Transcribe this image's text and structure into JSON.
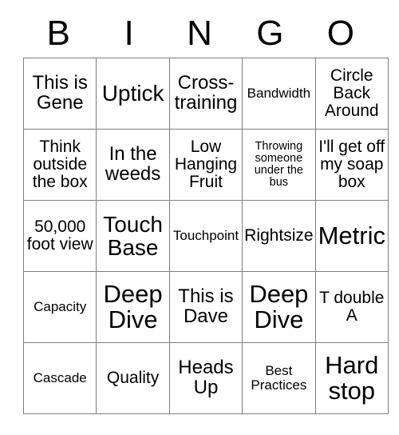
{
  "card": {
    "header_letters": [
      "B",
      "I",
      "N",
      "G",
      "O"
    ],
    "rows": [
      [
        {
          "text": "This is Gene",
          "size": "l"
        },
        {
          "text": "Uptick",
          "size": "xl"
        },
        {
          "text": "Cross-training",
          "size": "l"
        },
        {
          "text": "Bandwidth",
          "size": "s"
        },
        {
          "text": "Circle Back Around",
          "size": "m"
        }
      ],
      [
        {
          "text": "Think outside the box",
          "size": "m"
        },
        {
          "text": "In the weeds",
          "size": "l"
        },
        {
          "text": "Low Hanging Fruit",
          "size": "m"
        },
        {
          "text": "Throwing someone under the bus",
          "size": "xs"
        },
        {
          "text": "I'll get off my soap box",
          "size": "m"
        }
      ],
      [
        {
          "text": "50,000 foot view",
          "size": "m"
        },
        {
          "text": "Touch Base",
          "size": "xl"
        },
        {
          "text": "Touchpoint",
          "size": "s"
        },
        {
          "text": "Rightsize",
          "size": "m"
        },
        {
          "text": "Metric",
          "size": "xxl"
        }
      ],
      [
        {
          "text": "Capacity",
          "size": "s"
        },
        {
          "text": "Deep Dive",
          "size": "xxl"
        },
        {
          "text": "This is Dave",
          "size": "l"
        },
        {
          "text": "Deep Dive",
          "size": "xxl"
        },
        {
          "text": "T double A",
          "size": "m"
        }
      ],
      [
        {
          "text": "Cascade",
          "size": "s"
        },
        {
          "text": "Quality",
          "size": "m"
        },
        {
          "text": "Heads Up",
          "size": "l"
        },
        {
          "text": "Best Practices",
          "size": "s"
        },
        {
          "text": "Hard stop",
          "size": "xxl"
        }
      ]
    ]
  },
  "colors": {
    "grid_line": "#7f7f7f",
    "text": "#000000",
    "background": "#ffffff"
  }
}
